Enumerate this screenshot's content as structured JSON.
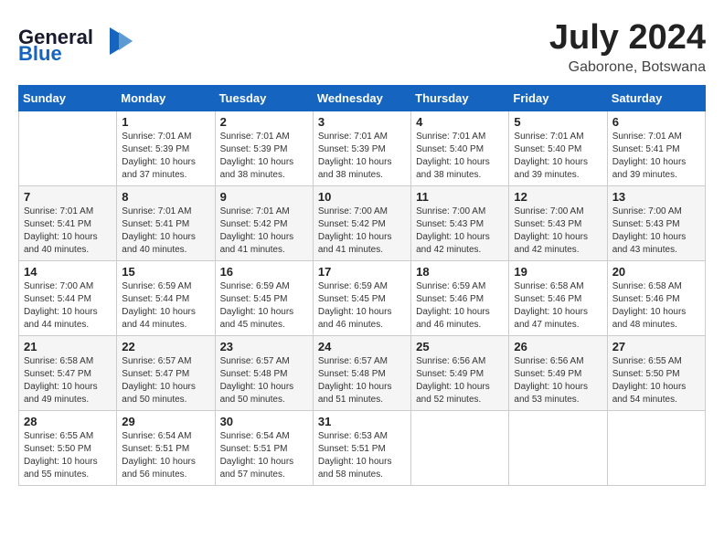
{
  "header": {
    "logo_general": "General",
    "logo_blue": "Blue",
    "month_year": "July 2024",
    "location": "Gaborone, Botswana"
  },
  "days_of_week": [
    "Sunday",
    "Monday",
    "Tuesday",
    "Wednesday",
    "Thursday",
    "Friday",
    "Saturday"
  ],
  "weeks": [
    [
      {
        "day": "",
        "info": ""
      },
      {
        "day": "1",
        "info": "Sunrise: 7:01 AM\nSunset: 5:39 PM\nDaylight: 10 hours\nand 37 minutes."
      },
      {
        "day": "2",
        "info": "Sunrise: 7:01 AM\nSunset: 5:39 PM\nDaylight: 10 hours\nand 38 minutes."
      },
      {
        "day": "3",
        "info": "Sunrise: 7:01 AM\nSunset: 5:39 PM\nDaylight: 10 hours\nand 38 minutes."
      },
      {
        "day": "4",
        "info": "Sunrise: 7:01 AM\nSunset: 5:40 PM\nDaylight: 10 hours\nand 38 minutes."
      },
      {
        "day": "5",
        "info": "Sunrise: 7:01 AM\nSunset: 5:40 PM\nDaylight: 10 hours\nand 39 minutes."
      },
      {
        "day": "6",
        "info": "Sunrise: 7:01 AM\nSunset: 5:41 PM\nDaylight: 10 hours\nand 39 minutes."
      }
    ],
    [
      {
        "day": "7",
        "info": "Sunrise: 7:01 AM\nSunset: 5:41 PM\nDaylight: 10 hours\nand 40 minutes."
      },
      {
        "day": "8",
        "info": "Sunrise: 7:01 AM\nSunset: 5:41 PM\nDaylight: 10 hours\nand 40 minutes."
      },
      {
        "day": "9",
        "info": "Sunrise: 7:01 AM\nSunset: 5:42 PM\nDaylight: 10 hours\nand 41 minutes."
      },
      {
        "day": "10",
        "info": "Sunrise: 7:00 AM\nSunset: 5:42 PM\nDaylight: 10 hours\nand 41 minutes."
      },
      {
        "day": "11",
        "info": "Sunrise: 7:00 AM\nSunset: 5:43 PM\nDaylight: 10 hours\nand 42 minutes."
      },
      {
        "day": "12",
        "info": "Sunrise: 7:00 AM\nSunset: 5:43 PM\nDaylight: 10 hours\nand 42 minutes."
      },
      {
        "day": "13",
        "info": "Sunrise: 7:00 AM\nSunset: 5:43 PM\nDaylight: 10 hours\nand 43 minutes."
      }
    ],
    [
      {
        "day": "14",
        "info": "Sunrise: 7:00 AM\nSunset: 5:44 PM\nDaylight: 10 hours\nand 44 minutes."
      },
      {
        "day": "15",
        "info": "Sunrise: 6:59 AM\nSunset: 5:44 PM\nDaylight: 10 hours\nand 44 minutes."
      },
      {
        "day": "16",
        "info": "Sunrise: 6:59 AM\nSunset: 5:45 PM\nDaylight: 10 hours\nand 45 minutes."
      },
      {
        "day": "17",
        "info": "Sunrise: 6:59 AM\nSunset: 5:45 PM\nDaylight: 10 hours\nand 46 minutes."
      },
      {
        "day": "18",
        "info": "Sunrise: 6:59 AM\nSunset: 5:46 PM\nDaylight: 10 hours\nand 46 minutes."
      },
      {
        "day": "19",
        "info": "Sunrise: 6:58 AM\nSunset: 5:46 PM\nDaylight: 10 hours\nand 47 minutes."
      },
      {
        "day": "20",
        "info": "Sunrise: 6:58 AM\nSunset: 5:46 PM\nDaylight: 10 hours\nand 48 minutes."
      }
    ],
    [
      {
        "day": "21",
        "info": "Sunrise: 6:58 AM\nSunset: 5:47 PM\nDaylight: 10 hours\nand 49 minutes."
      },
      {
        "day": "22",
        "info": "Sunrise: 6:57 AM\nSunset: 5:47 PM\nDaylight: 10 hours\nand 50 minutes."
      },
      {
        "day": "23",
        "info": "Sunrise: 6:57 AM\nSunset: 5:48 PM\nDaylight: 10 hours\nand 50 minutes."
      },
      {
        "day": "24",
        "info": "Sunrise: 6:57 AM\nSunset: 5:48 PM\nDaylight: 10 hours\nand 51 minutes."
      },
      {
        "day": "25",
        "info": "Sunrise: 6:56 AM\nSunset: 5:49 PM\nDaylight: 10 hours\nand 52 minutes."
      },
      {
        "day": "26",
        "info": "Sunrise: 6:56 AM\nSunset: 5:49 PM\nDaylight: 10 hours\nand 53 minutes."
      },
      {
        "day": "27",
        "info": "Sunrise: 6:55 AM\nSunset: 5:50 PM\nDaylight: 10 hours\nand 54 minutes."
      }
    ],
    [
      {
        "day": "28",
        "info": "Sunrise: 6:55 AM\nSunset: 5:50 PM\nDaylight: 10 hours\nand 55 minutes."
      },
      {
        "day": "29",
        "info": "Sunrise: 6:54 AM\nSunset: 5:51 PM\nDaylight: 10 hours\nand 56 minutes."
      },
      {
        "day": "30",
        "info": "Sunrise: 6:54 AM\nSunset: 5:51 PM\nDaylight: 10 hours\nand 57 minutes."
      },
      {
        "day": "31",
        "info": "Sunrise: 6:53 AM\nSunset: 5:51 PM\nDaylight: 10 hours\nand 58 minutes."
      },
      {
        "day": "",
        "info": ""
      },
      {
        "day": "",
        "info": ""
      },
      {
        "day": "",
        "info": ""
      }
    ]
  ]
}
